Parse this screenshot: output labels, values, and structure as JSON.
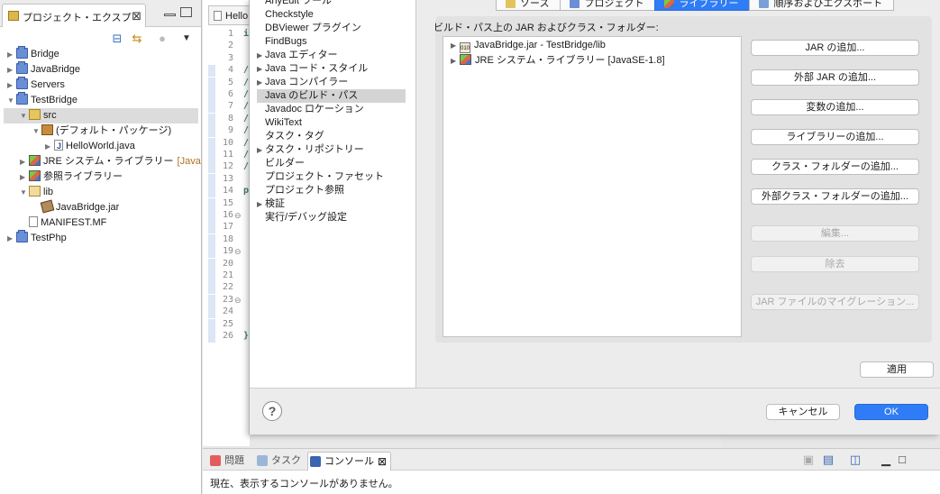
{
  "explorer": {
    "tab_label": "プロジェクト・エクスプ",
    "tab_close": "⊠",
    "tree": [
      {
        "label": "Bridge",
        "icon": "project-icon",
        "indent": 0,
        "twisty": "▶"
      },
      {
        "label": "JavaBridge",
        "icon": "project-icon",
        "indent": 0,
        "twisty": "▶"
      },
      {
        "label": "Servers",
        "icon": "project-icon",
        "indent": 0,
        "twisty": "▶"
      },
      {
        "label": "TestBridge",
        "icon": "project-icon",
        "indent": 0,
        "twisty": "▼"
      },
      {
        "label": "src",
        "icon": "package-root-icon",
        "indent": 1,
        "twisty": "▼",
        "selected": true
      },
      {
        "label": "(デフォルト・パッケージ)",
        "icon": "package-icon",
        "indent": 2,
        "twisty": "▼"
      },
      {
        "label": "HelloWorld.java",
        "icon": "java-file-icon",
        "indent": 3,
        "twisty": "▶"
      },
      {
        "label": "JRE システム・ライブラリー",
        "suffix": "[Java",
        "icon": "library-icon",
        "indent": 1,
        "twisty": "▶"
      },
      {
        "label": "参照ライブラリー",
        "icon": "library-icon",
        "indent": 1,
        "twisty": "▶"
      },
      {
        "label": "lib",
        "icon": "folder-icon",
        "indent": 1,
        "twisty": "▼"
      },
      {
        "label": "JavaBridge.jar",
        "icon": "jar-icon",
        "indent": 2,
        "twisty": ""
      },
      {
        "label": "MANIFEST.MF",
        "icon": "manifest-icon",
        "indent": 1,
        "twisty": ""
      },
      {
        "label": "TestPhp",
        "icon": "project-icon",
        "indent": 0,
        "twisty": "▶"
      }
    ]
  },
  "editor": {
    "tab_label": "Hello",
    "line_numbers": [
      "1",
      "2",
      "3",
      "4",
      "5",
      "6",
      "7",
      "8",
      "9",
      "10",
      "11",
      "12",
      "13",
      "14",
      "15",
      "16",
      "17",
      "18",
      "19",
      "20",
      "21",
      "22",
      "23",
      "24",
      "25",
      "26"
    ],
    "code_chars": {
      "1": "i",
      "4": "/",
      "5": "/",
      "6": "/",
      "7": "/",
      "8": "/",
      "9": "/",
      "10": "/",
      "11": "/",
      "12": "/",
      "14": "p",
      "26": "}"
    },
    "fold_lines": [
      "16",
      "19",
      "23"
    ]
  },
  "dialog": {
    "categories": [
      {
        "label": "AnyEdit ツール",
        "arrow": ""
      },
      {
        "label": "Checkstyle",
        "arrow": ""
      },
      {
        "label": "DBViewer プラグイン",
        "arrow": ""
      },
      {
        "label": "FindBugs",
        "arrow": ""
      },
      {
        "label": "Java エディター",
        "arrow": "▶"
      },
      {
        "label": "Java コード・スタイル",
        "arrow": "▶"
      },
      {
        "label": "Java コンパイラー",
        "arrow": "▶"
      },
      {
        "label": "Java のビルド・パス",
        "arrow": "",
        "selected": true
      },
      {
        "label": "Javadoc ロケーション",
        "arrow": ""
      },
      {
        "label": "WikiText",
        "arrow": ""
      },
      {
        "label": "タスク・タグ",
        "arrow": ""
      },
      {
        "label": "タスク・リポジトリー",
        "arrow": "▶"
      },
      {
        "label": "ビルダー",
        "arrow": ""
      },
      {
        "label": "プロジェクト・ファセット",
        "arrow": ""
      },
      {
        "label": "プロジェクト参照",
        "arrow": ""
      },
      {
        "label": "検証",
        "arrow": "▶"
      },
      {
        "label": "実行/デバッグ設定",
        "arrow": ""
      }
    ],
    "tabs": [
      {
        "label": "ソース",
        "icon": "source-folder-icon",
        "active": false
      },
      {
        "label": "プロジェクト",
        "icon": "project-icon",
        "active": false
      },
      {
        "label": "ライブラリー",
        "icon": "library-icon",
        "active": true
      },
      {
        "label": "順序およびエクスポート",
        "icon": "order-icon",
        "active": false
      }
    ],
    "group_label": "ビルド・パス上の JAR およびクラス・フォルダー:",
    "jar_entries": [
      {
        "label": "JavaBridge.jar - TestBridge/lib",
        "icon": "jar-icon"
      },
      {
        "label": "JRE システム・ライブラリー [JavaSE-1.8]",
        "icon": "library-icon"
      }
    ],
    "buttons": [
      {
        "label": "JAR の追加...",
        "enabled": true
      },
      {
        "label": "外部 JAR の追加...",
        "enabled": true
      },
      {
        "label": "変数の追加...",
        "enabled": true
      },
      {
        "label": "ライブラリーの追加...",
        "enabled": true
      },
      {
        "label": "クラス・フォルダーの追加...",
        "enabled": true
      },
      {
        "label": "外部クラス・フォルダーの追加...",
        "enabled": true
      },
      {
        "label": "編集...",
        "enabled": false
      },
      {
        "label": "除去",
        "enabled": false
      },
      {
        "label": "JAR ファイルのマイグレーション...",
        "enabled": false
      }
    ],
    "apply_label": "適用",
    "help_label": "?",
    "cancel_label": "キャンセル",
    "ok_label": "OK",
    "accent_color": "#2f7cf6"
  },
  "console": {
    "tabs": [
      {
        "label": "問題",
        "icon": "problems-icon",
        "active": false
      },
      {
        "label": "タスク",
        "icon": "tasks-icon",
        "active": false
      },
      {
        "label": "コンソール",
        "icon": "console-icon",
        "active": true
      }
    ],
    "close": "⊠",
    "message": "現在、表示するコンソールがありません。"
  }
}
